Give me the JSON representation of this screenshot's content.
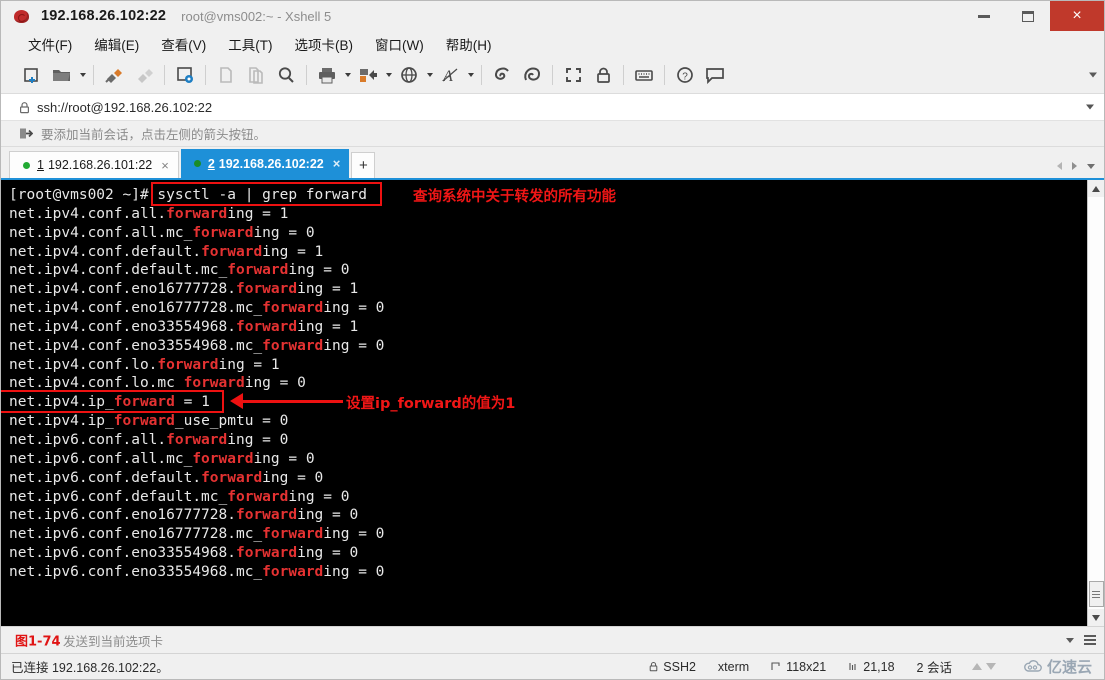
{
  "window": {
    "title": "192.168.26.102:22",
    "subtitle": "root@vms002:~ - Xshell 5",
    "app_icon": "xshell-icon",
    "controls": {
      "minimize": "minimize-button",
      "maximize": "maximize-button",
      "close": "×"
    }
  },
  "menubar": {
    "items": [
      {
        "label": "文件(F)",
        "name": "menu-file"
      },
      {
        "label": "编辑(E)",
        "name": "menu-edit"
      },
      {
        "label": "查看(V)",
        "name": "menu-view"
      },
      {
        "label": "工具(T)",
        "name": "menu-tools"
      },
      {
        "label": "选项卡(B)",
        "name": "menu-tabs"
      },
      {
        "label": "窗口(W)",
        "name": "menu-window"
      },
      {
        "label": "帮助(H)",
        "name": "menu-help"
      }
    ]
  },
  "toolbar": {
    "icons": [
      "new-session-icon",
      "open-folder-icon",
      "caret-down-icon",
      "separator",
      "connect-icon",
      "disconnect-icon",
      "separator",
      "session-properties-icon",
      "separator",
      "copy-icon",
      "paste-icon",
      "find-icon",
      "separator",
      "print-icon",
      "caret-down-icon",
      "transfer-icon",
      "caret-down-icon",
      "globe-icon",
      "caret-down-icon",
      "font-icon",
      "caret-down-icon",
      "separator",
      "xftp-icon",
      "xagent-icon",
      "separator",
      "fullscreen-icon",
      "lock-icon",
      "separator",
      "keyboard-icon",
      "separator",
      "help-icon",
      "chat-icon"
    ],
    "overflow": "toolbar-overflow-icon"
  },
  "address_bar": {
    "lock_icon": "lock-icon",
    "value": "ssh://root@192.168.26.102:22",
    "dropdown_icon": "chevron-down-icon"
  },
  "notify_bar": {
    "icon": "add-session-arrow-icon",
    "text": "要添加当前会话，点击左侧的箭头按钮。"
  },
  "tabs": {
    "items": [
      {
        "number": "1",
        "label": "192.168.26.101:22",
        "active": false,
        "status": "connected",
        "close": "×"
      },
      {
        "number": "2",
        "label": "192.168.26.102:22",
        "active": true,
        "status": "connected",
        "close": "×"
      }
    ],
    "add_label": "+",
    "nav": {
      "prev": "tab-prev-icon",
      "next": "tab-next-icon",
      "list": "tab-list-icon"
    }
  },
  "terminal": {
    "prompt": "[root@vms002 ~]# ",
    "command": "sysctl -a | grep forward",
    "match_word": "forward",
    "lines": [
      "net.ipv4.conf.all.forwarding = 1",
      "net.ipv4.conf.all.mc_forwarding = 0",
      "net.ipv4.conf.default.forwarding = 1",
      "net.ipv4.conf.default.mc_forwarding = 0",
      "net.ipv4.conf.eno16777728.forwarding = 1",
      "net.ipv4.conf.eno16777728.mc_forwarding = 0",
      "net.ipv4.conf.eno33554968.forwarding = 1",
      "net.ipv4.conf.eno33554968.mc_forwarding = 0",
      "net.ipv4.conf.lo.forwarding = 1",
      "net.ipv4.conf.lo.mc_forwarding = 0",
      "net.ipv4.ip_forward = 1",
      "net.ipv4.ip_forward_use_pmtu = 0",
      "net.ipv6.conf.all.forwarding = 0",
      "net.ipv6.conf.all.mc_forwarding = 0",
      "net.ipv6.conf.default.forwarding = 0",
      "net.ipv6.conf.default.mc_forwarding = 0",
      "net.ipv6.conf.eno16777728.forwarding = 0",
      "net.ipv6.conf.eno16777728.mc_forwarding = 0",
      "net.ipv6.conf.eno33554968.forwarding = 0",
      "net.ipv6.conf.eno33554968.mc_forwarding = 0"
    ],
    "colors": {
      "background": "#000000",
      "text": "#e8e8e8",
      "match": "#e53232"
    }
  },
  "annotations": {
    "color": "#ee1111",
    "command_note": "查询系统中关于转发的所有功能",
    "ip_forward_note": "设置ip_forward的值为1"
  },
  "sender_bar": {
    "text": "发送到当前选项卡",
    "figure_caption": "图1-74",
    "dropdown_icon": "chevron-down-icon",
    "menu_icon": "hamburger-icon"
  },
  "status_bar": {
    "connection": "已连接 192.168.26.102:22。",
    "protocol": "SSH2",
    "protocol_icon": "lock-icon",
    "terminal_type": "xterm",
    "size": "118x21",
    "size_icon": "resize-icon",
    "cursor": "21,18",
    "cursor_icon": "cursor-position-icon",
    "sessions": "2 会话",
    "upload_icon": "upload-arrow-icon",
    "download_icon": "download-arrow-icon",
    "watermark": "亿速云",
    "watermark_icon": "cloud-icon"
  }
}
